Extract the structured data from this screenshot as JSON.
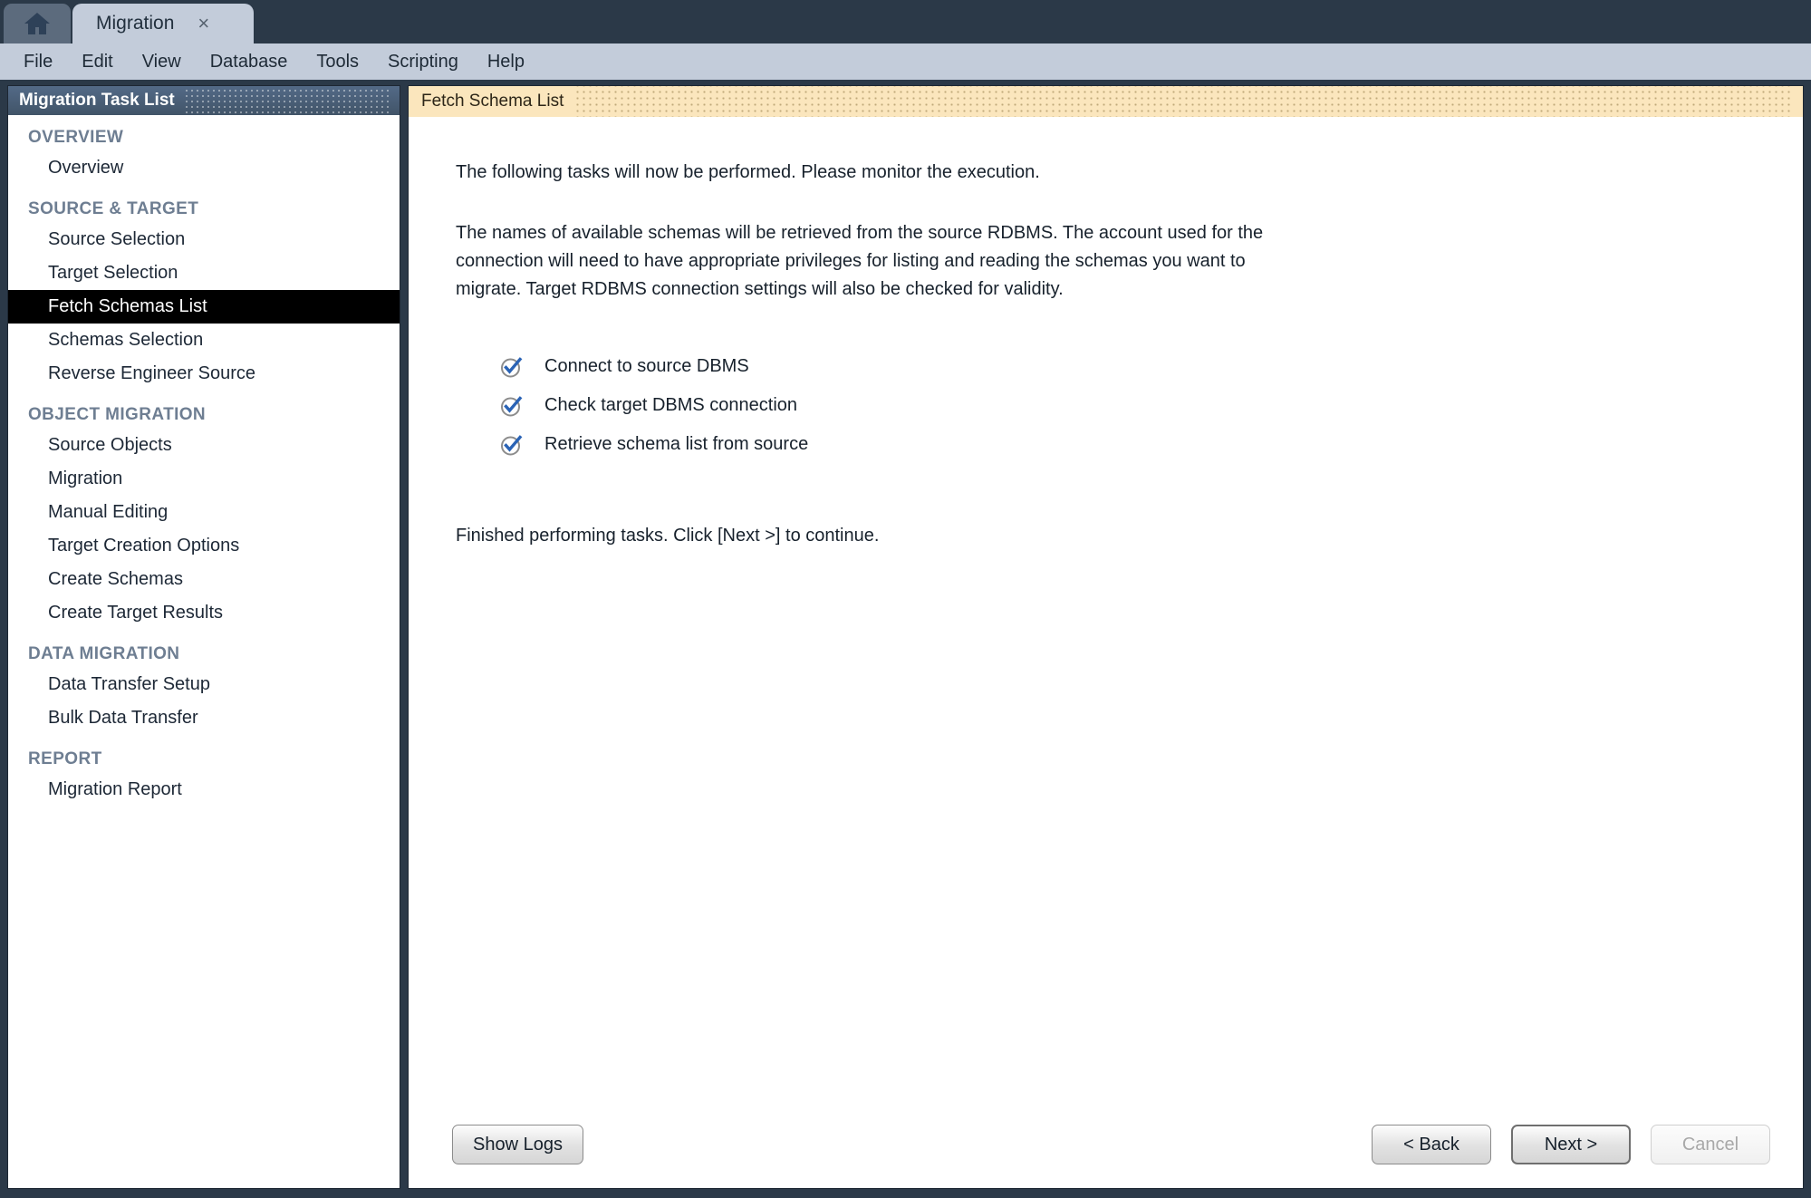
{
  "window": {
    "home_tab_icon": "home-icon",
    "active_tab": {
      "label": "Migration",
      "close_glyph": "×"
    }
  },
  "menu": {
    "items": [
      {
        "label": "File"
      },
      {
        "label": "Edit"
      },
      {
        "label": "View"
      },
      {
        "label": "Database"
      },
      {
        "label": "Tools"
      },
      {
        "label": "Scripting"
      },
      {
        "label": "Help"
      }
    ]
  },
  "sidebar": {
    "header_title": "Migration Task List",
    "sections": [
      {
        "title": "OVERVIEW",
        "items": [
          {
            "label": "Overview",
            "selected": false
          }
        ]
      },
      {
        "title": "SOURCE & TARGET",
        "items": [
          {
            "label": "Source Selection",
            "selected": false
          },
          {
            "label": "Target Selection",
            "selected": false
          },
          {
            "label": "Fetch Schemas List",
            "selected": true
          },
          {
            "label": "Schemas Selection",
            "selected": false
          },
          {
            "label": "Reverse Engineer Source",
            "selected": false
          }
        ]
      },
      {
        "title": "OBJECT MIGRATION",
        "items": [
          {
            "label": "Source Objects",
            "selected": false
          },
          {
            "label": "Migration",
            "selected": false
          },
          {
            "label": "Manual Editing",
            "selected": false
          },
          {
            "label": "Target Creation Options",
            "selected": false
          },
          {
            "label": "Create Schemas",
            "selected": false
          },
          {
            "label": "Create Target Results",
            "selected": false
          }
        ]
      },
      {
        "title": "DATA MIGRATION",
        "items": [
          {
            "label": "Data Transfer Setup",
            "selected": false
          },
          {
            "label": "Bulk Data Transfer",
            "selected": false
          }
        ]
      },
      {
        "title": "REPORT",
        "items": [
          {
            "label": "Migration Report",
            "selected": false
          }
        ]
      }
    ]
  },
  "content": {
    "header_title": "Fetch Schema List",
    "intro_paragraph": "The following tasks will now be performed. Please monitor the execution.",
    "detail_paragraph": "The names of available schemas will be retrieved from the source RDBMS. The account used for the connection will need to have appropriate privileges for listing and reading the schemas you want to migrate. Target RDBMS connection settings will also be checked for validity.",
    "tasks": [
      {
        "label": "Connect to source DBMS",
        "state": "done",
        "icon": "check-circle-icon"
      },
      {
        "label": "Check target DBMS connection",
        "state": "done",
        "icon": "check-circle-icon"
      },
      {
        "label": "Retrieve schema list from source",
        "state": "done",
        "icon": "check-circle-icon"
      }
    ],
    "status_text": "Finished performing tasks. Click [Next >] to continue."
  },
  "footer": {
    "show_logs_label": "Show Logs",
    "back_label": "< Back",
    "next_label": "Next >",
    "cancel_label": "Cancel",
    "cancel_enabled": false
  },
  "colors": {
    "window_frame": "#2b3948",
    "menu_bar": "#c3ccda",
    "sidebar_header": "#4a5f7a",
    "content_header": "#fbe6bd",
    "selected_item_bg": "#000000",
    "check_accent": "#2a63b5",
    "section_label": "#6e7e92"
  }
}
